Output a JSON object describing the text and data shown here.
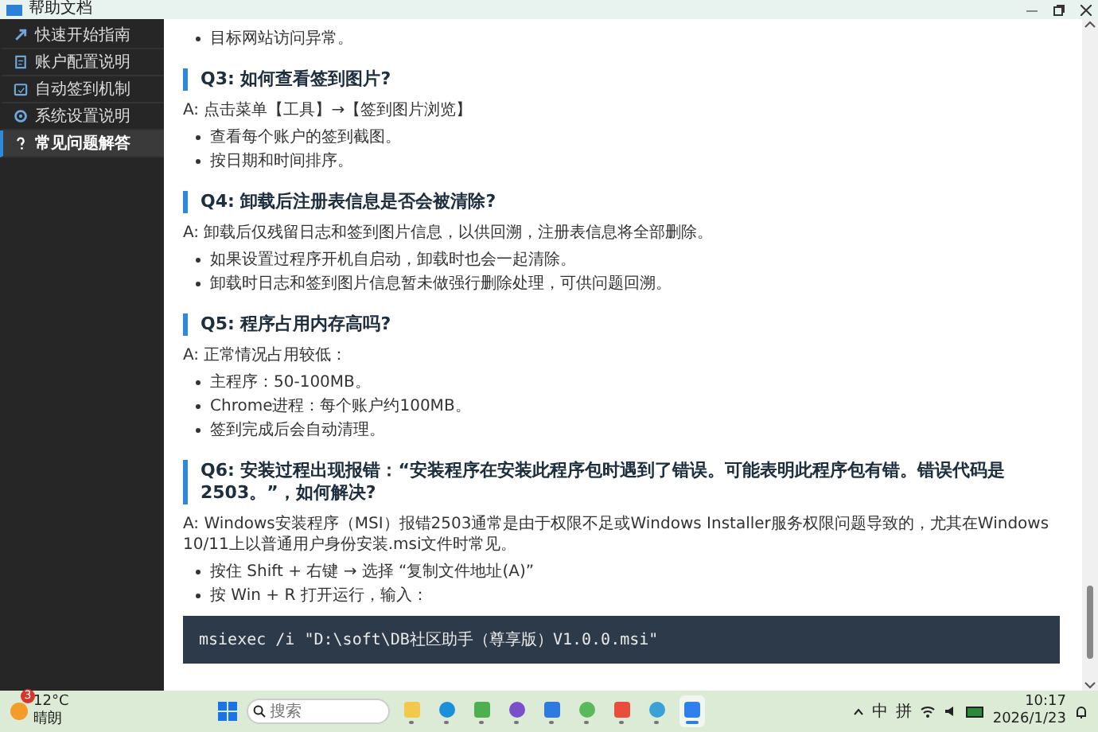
{
  "window": {
    "title": "帮助文档"
  },
  "sidebar": {
    "items": [
      {
        "label": "快速开始指南",
        "selected": false
      },
      {
        "label": "账户配置说明",
        "selected": false
      },
      {
        "label": "自动签到机制",
        "selected": false
      },
      {
        "label": "系统设置说明",
        "selected": false
      },
      {
        "label": "常见问题解答",
        "selected": true
      }
    ]
  },
  "content": {
    "sections": [
      {
        "bullets": [
          "目标网站访问异常。"
        ]
      },
      {
        "heading": "Q3: 如何查看签到图片?",
        "answer": "A: 点击菜单【工具】→【签到图片浏览】",
        "bullets": [
          "查看每个账户的签到截图。",
          "按日期和时间排序。"
        ]
      },
      {
        "heading": "Q4: 卸载后注册表信息是否会被清除?",
        "answer": "A: 卸载后仅残留日志和签到图片信息，以供回溯，注册表信息将全部删除。",
        "bullets": [
          "如果设置过程序开机自启动，卸载时也会一起清除。",
          "卸载时日志和签到图片信息暂未做强行删除处理，可供问题回溯。"
        ]
      },
      {
        "heading": "Q5: 程序占用内存高吗?",
        "answer": "A: 正常情况占用较低：",
        "bullets": [
          "主程序：50-100MB。",
          "Chrome进程：每个账户约100MB。",
          "签到完成后会自动清理。"
        ]
      },
      {
        "heading": "Q6: 安装过程出现报错：“安装程序在安装此程序包时遇到了错误。可能表明此程序包有错。错误代码是2503。”，如何解决?",
        "answer": "A: Windows安装程序（MSI）报错2503通常是由于权限不足或Windows Installer服务权限问题导致的，尤其在Windows 10/11上以普通用户身份安装.msi文件时常见。",
        "bullets": [
          "按住 Shift + 右键 → 选择 “复制文件地址(A)”",
          "按 Win + R 打开运行，输入："
        ],
        "code": "msiexec /i \"D:\\soft\\DB社区助手（尊享版）V1.0.0.msi\""
      }
    ]
  },
  "taskbar": {
    "weather": {
      "badge": "3",
      "temperature": "12°C",
      "condition": "晴朗"
    },
    "search": {
      "placeholder": "搜索"
    },
    "apps": [
      {
        "selected": false
      },
      {
        "selected": false
      },
      {
        "selected": false
      },
      {
        "selected": false
      },
      {
        "selected": false
      },
      {
        "selected": false
      },
      {
        "selected": false
      },
      {
        "selected": false
      },
      {
        "selected": true
      }
    ],
    "ime": [
      "中",
      "拼"
    ],
    "clock": {
      "time": "10:17",
      "date": "2026/1/23"
    }
  }
}
